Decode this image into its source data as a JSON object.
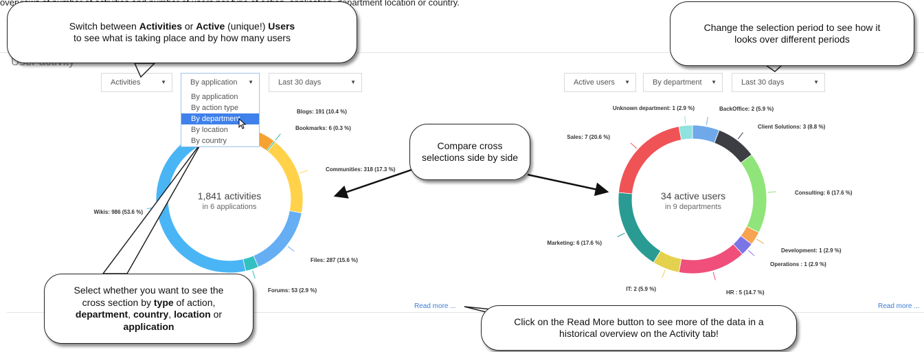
{
  "header": {
    "top_text": "overviews of number of activities and number of users per type of action, application, department location or country."
  },
  "section": {
    "title": "User activity"
  },
  "left": {
    "filters": {
      "metric": "Activities",
      "cross": "By application",
      "period": "Last 30 days"
    },
    "dropdown": [
      "By application",
      "By action type",
      "By department",
      "By location",
      "By country"
    ],
    "center": {
      "line1": "1,841 activities",
      "line2": "in 6 applications"
    },
    "read_more": "Read more ..."
  },
  "right": {
    "filters": {
      "metric": "Active users",
      "cross": "By department",
      "period": "Last 30 days"
    },
    "center": {
      "line1": "34 active users",
      "line2": "in 9 departments"
    },
    "read_more": "Read more ..."
  },
  "callouts": {
    "switch": {
      "t1": "Switch between ",
      "b1": "Activities",
      "t2": " or ",
      "b2": "Active",
      "t3": " (unique!) ",
      "b3": "Users",
      "t4": " to see what is taking place and by how many users"
    },
    "period": "Change the selection period to see how it looks over different periods",
    "compare": "Compare cross selections side by side",
    "select": {
      "t1": "Select whether you want to see the cross section by ",
      "b1": "type",
      "t2": " of action, ",
      "b2": "department",
      "t3": ", ",
      "b3": "country",
      "t4": ", ",
      "b4": "location",
      "t5": " or ",
      "b5": "application"
    },
    "readmore": "Click on the Read More button to see more of the data in a historical overview on the Activity tab!"
  },
  "chart_data": [
    {
      "type": "pie",
      "series": [
        {
          "name": "Blogs",
          "value": 191,
          "label": "Blogs: 191 (10.4 %)",
          "color": "#f5a133"
        },
        {
          "name": "Bookmarks",
          "value": 6,
          "label": "Bookmarks: 6 (0.3 %)",
          "color": "#2fb9a6"
        },
        {
          "name": "Communities",
          "value": 318,
          "label": "Communities: 318 (17.3 %)",
          "color": "#ffd24a"
        },
        {
          "name": "Files",
          "value": 287,
          "label": "Files: 287 (15.6 %)",
          "color": "#66aef3"
        },
        {
          "name": "Forums",
          "value": 53,
          "label": "Forums: 53 (2.9 %)",
          "color": "#32c1c0"
        },
        {
          "name": "Wikis",
          "value": 986,
          "label": "Wikis: 986 (53.6 %)",
          "color": "#4ab5f5"
        }
      ]
    },
    {
      "type": "pie",
      "series": [
        {
          "name": "BackOffice",
          "value": 2,
          "label": "BackOffice: 2 (5.9 %)",
          "color": "#6fa9ea"
        },
        {
          "name": "Client Solutions",
          "value": 3,
          "label": "Client Solutions: 3 (8.8 %)",
          "color": "#3d3e44"
        },
        {
          "name": "Consulting",
          "value": 6,
          "label": "Consulting: 6 (17.6 %)",
          "color": "#8fe57a"
        },
        {
          "name": "Development",
          "value": 1,
          "label": "Development: 1 (2.9 %)",
          "color": "#f7a350"
        },
        {
          "name": "Operations",
          "value": 1,
          "label": "Operations : 1 (2.9 %)",
          "color": "#7b75e6"
        },
        {
          "name": "HR",
          "value": 5,
          "label": "HR : 5 (14.7 %)",
          "color": "#ef4f7a"
        },
        {
          "name": "IT",
          "value": 2,
          "label": "IT: 2 (5.9 %)",
          "color": "#e4d24f"
        },
        {
          "name": "Marketing",
          "value": 6,
          "label": "Marketing: 6 (17.6 %)",
          "color": "#2a9b93"
        },
        {
          "name": "Sales",
          "value": 7,
          "label": "Sales: 7 (20.6 %)",
          "color": "#ef5355"
        },
        {
          "name": "Unknown department",
          "value": 1,
          "label": "Unknown department: 1 (2.9 %)",
          "color": "#8fe3df"
        }
      ]
    }
  ]
}
